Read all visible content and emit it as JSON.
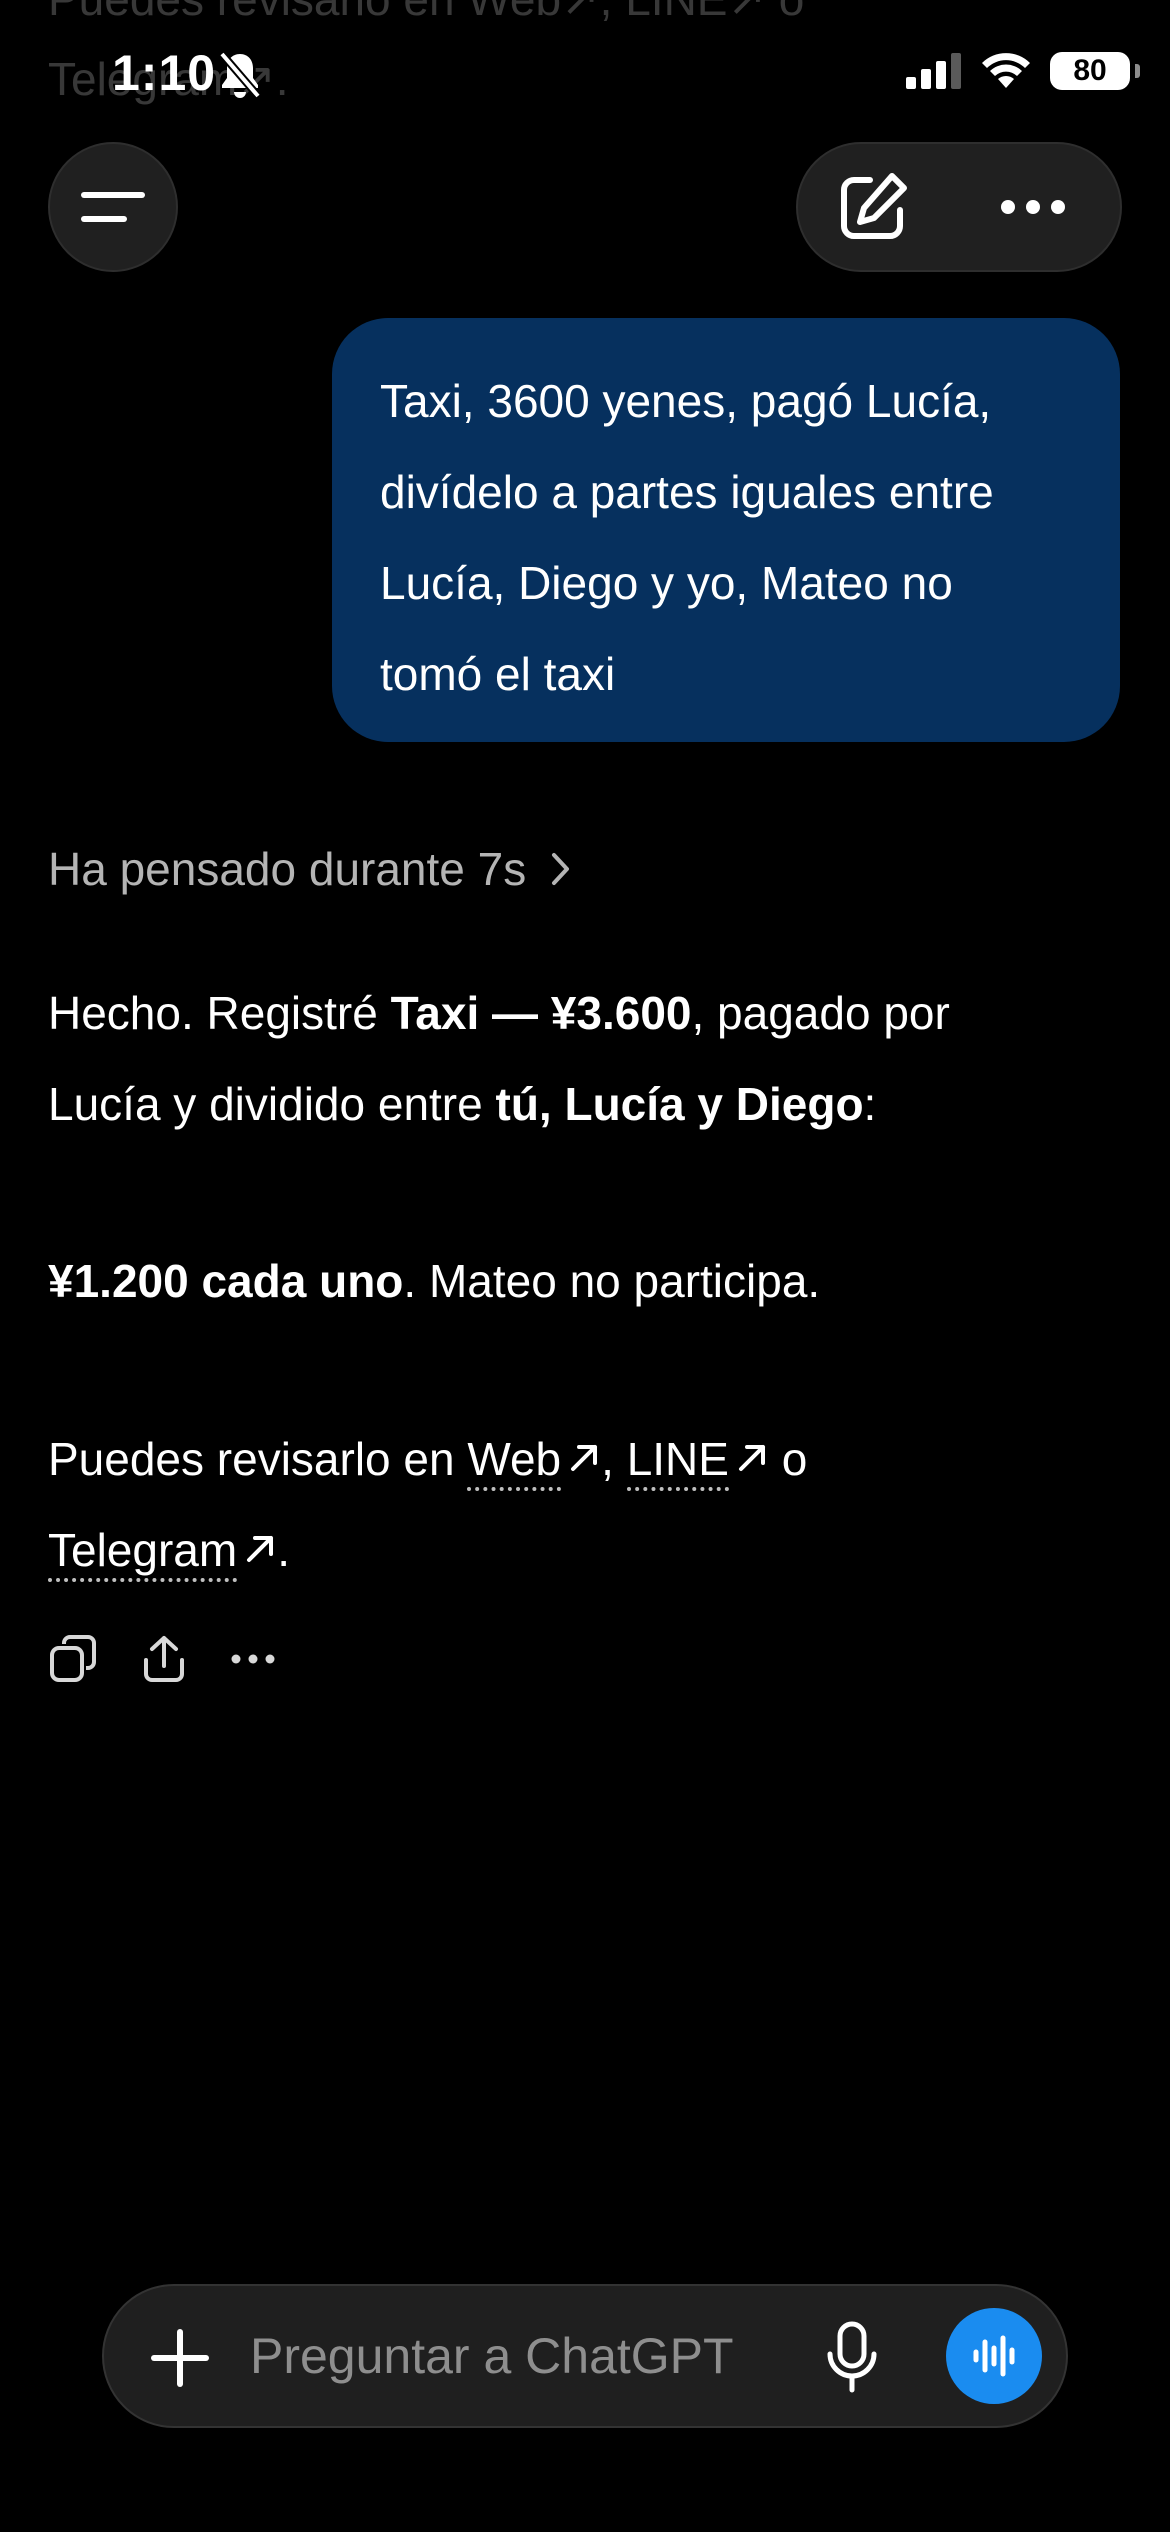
{
  "status_bar": {
    "time": "1:10",
    "battery": "80"
  },
  "ghost": {
    "line1": "Puedes revisarlo en Web↗, LINE↗ o",
    "line2": "Telegram↗."
  },
  "user_message": {
    "lines": [
      "Taxi, 3600 yenes, pagó Lucía,",
      "divídelo a partes iguales entre",
      "Lucía, Diego y yo, Mateo no",
      "tomó el taxi"
    ]
  },
  "thinking": {
    "label": "Ha pensado durante 7s"
  },
  "answer": {
    "p1_a": "Hecho. Registré ",
    "p1_b": "Taxi — ¥3.600",
    "p1_c": ", pagado por",
    "p1_d": "Lucía y dividido entre ",
    "p1_e": "tú, Lucía y Diego",
    "p1_f": ":",
    "p2_a": "¥1.200 cada uno",
    "p2_b": ". Mateo no participa.",
    "p3_a": "Puedes revisarlo en ",
    "link_web": "Web",
    "sep1": ", ",
    "link_line": "LINE",
    "sep2": " o",
    "link_telegram": "Telegram",
    "end": "."
  },
  "composer": {
    "placeholder": "Preguntar a ChatGPT"
  },
  "icons": {
    "menu": "menu-icon",
    "new_chat": "edit-icon",
    "more": "more-icon",
    "copy": "copy-icon",
    "share": "share-icon",
    "plus": "plus-icon",
    "mic": "mic-icon",
    "voice": "voice-wave-icon"
  },
  "colors": {
    "user_bubble": "#06305e",
    "voice_button": "#1a8cf0",
    "background": "#000000"
  }
}
